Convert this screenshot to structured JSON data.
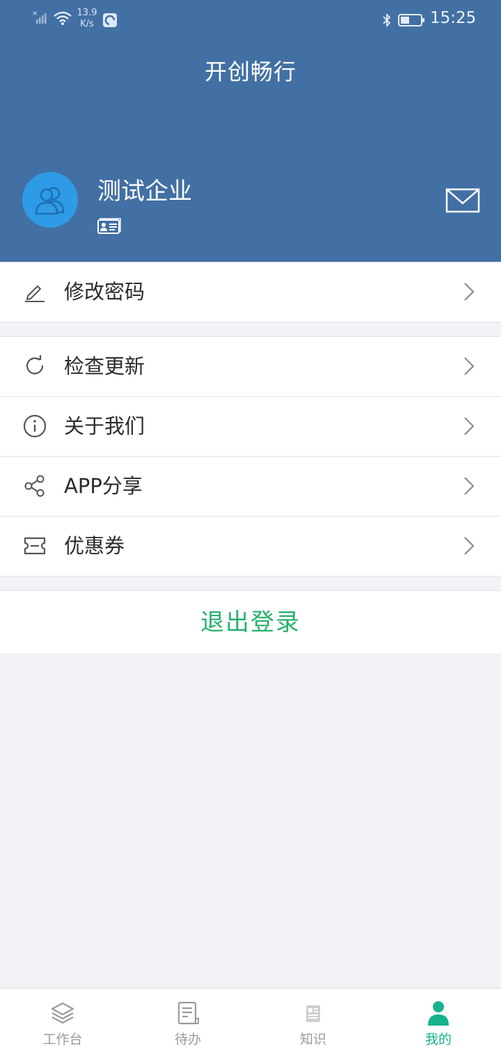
{
  "status_bar": {
    "network_speed_value": "13.9",
    "network_speed_unit": "K/s",
    "time": "15:25",
    "icons": [
      "signal-icon",
      "wifi-icon",
      "app-notification-icon",
      "bluetooth-icon",
      "battery-icon"
    ]
  },
  "header": {
    "title": "开创畅行",
    "company_name": "测试企业",
    "background_color": "#4270a4",
    "avatar_color": "#2f9be6",
    "icons": [
      "avatar-group-icon",
      "id-card-icon",
      "mail-icon"
    ]
  },
  "menu": {
    "group1": [
      {
        "label": "修改密码",
        "icon": "edit-icon"
      }
    ],
    "group2": [
      {
        "label": "检查更新",
        "icon": "refresh-icon"
      },
      {
        "label": "关于我们",
        "icon": "info-icon"
      },
      {
        "label": "APP分享",
        "icon": "share-icon"
      },
      {
        "label": "优惠券",
        "icon": "coupon-icon"
      }
    ]
  },
  "logout": {
    "label": "退出登录",
    "color": "#27b06d"
  },
  "tabbar": {
    "tabs": [
      {
        "label": "工作台",
        "icon": "layers-icon",
        "active": false
      },
      {
        "label": "待办",
        "icon": "todo-list-icon",
        "active": false
      },
      {
        "label": "知识",
        "icon": "news-icon",
        "active": false
      },
      {
        "label": "我的",
        "icon": "user-icon",
        "active": true
      }
    ],
    "active_color": "#17b28e",
    "inactive_color": "#9a9a9a"
  }
}
